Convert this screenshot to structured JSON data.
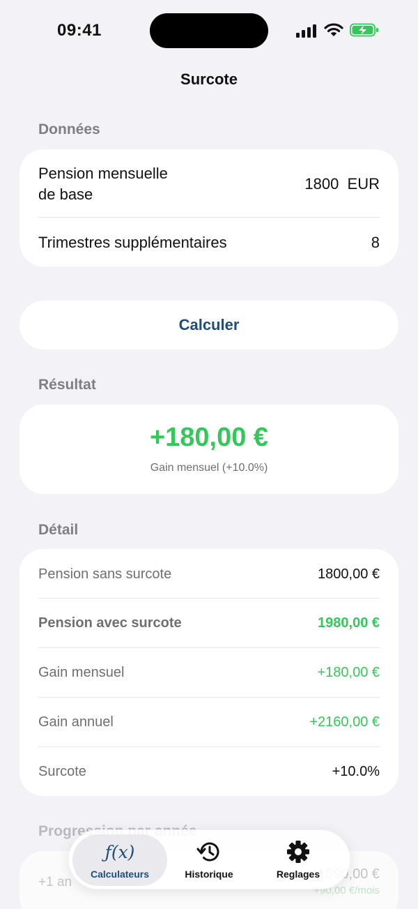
{
  "status_bar": {
    "time": "09:41"
  },
  "nav": {
    "title": "Surcote"
  },
  "donnees": {
    "header": "Données",
    "pension_label_line1": "Pension mensuelle",
    "pension_label_line2": "de base",
    "pension_value": "1800",
    "pension_unit": "EUR",
    "trimestres_label": "Trimestres supplémentaires",
    "trimestres_value": "8"
  },
  "calculate_button": "Calculer",
  "resultat": {
    "header": "Résultat",
    "amount": "+180,00 €",
    "subtitle": "Gain mensuel (+10.0%)"
  },
  "detail": {
    "header": "Détail",
    "rows": [
      {
        "label": "Pension sans surcote",
        "value": "1800,00 €"
      },
      {
        "label": "Pension avec surcote",
        "value": "1980,00 €"
      },
      {
        "label": "Gain mensuel",
        "value": "+180,00 €"
      },
      {
        "label": "Gain annuel",
        "value": "+2160,00 €"
      },
      {
        "label": "Surcote",
        "value": "+10.0%"
      }
    ]
  },
  "progression": {
    "header": "Progression par année",
    "first_row_label": "+1 an",
    "first_row_value": "1890,00 €",
    "first_row_sub": "+90,00 €/mois"
  },
  "tab_bar": {
    "tabs": [
      {
        "label": "Calculateurs",
        "icon": "function-icon",
        "active": true
      },
      {
        "label": "Historique",
        "icon": "history-icon",
        "active": false
      },
      {
        "label": "Reglages",
        "icon": "gear-icon",
        "active": false
      }
    ]
  },
  "colors": {
    "accent": "#1f4c7a",
    "positive": "#34c759",
    "background": "#f2f2f7"
  }
}
